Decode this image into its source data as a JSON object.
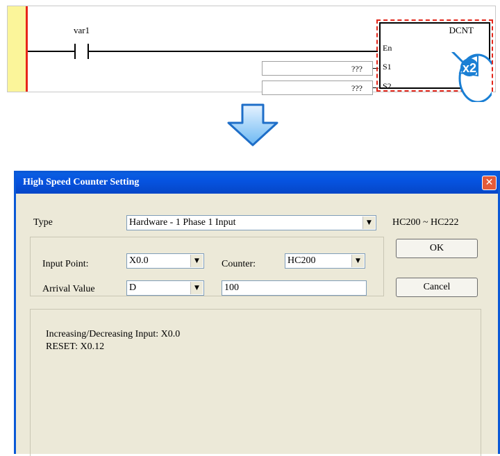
{
  "ladder": {
    "variable": "var1",
    "instruction": "DCNT",
    "pins": [
      "En",
      "S1",
      "S2"
    ],
    "operand_s1": "???",
    "operand_s2": "???",
    "badge": "x2"
  },
  "dialog": {
    "title": "High Speed Counter Setting",
    "close_icon": "close-icon",
    "type_label": "Type",
    "type_value": "Hardware - 1 Phase 1 Input",
    "range": "HC200 ~ HC222",
    "input_point_label": "Input Point:",
    "input_point_value": "X0.0",
    "counter_label": "Counter:",
    "counter_value": "HC200",
    "arrival_label": "Arrival Value",
    "arrival_type": "D",
    "arrival_value": "100",
    "ok_label": "OK",
    "cancel_label": "Cancel",
    "info_lines": [
      "Increasing/Decreasing Input: X0.0",
      "RESET: X0.12"
    ]
  }
}
